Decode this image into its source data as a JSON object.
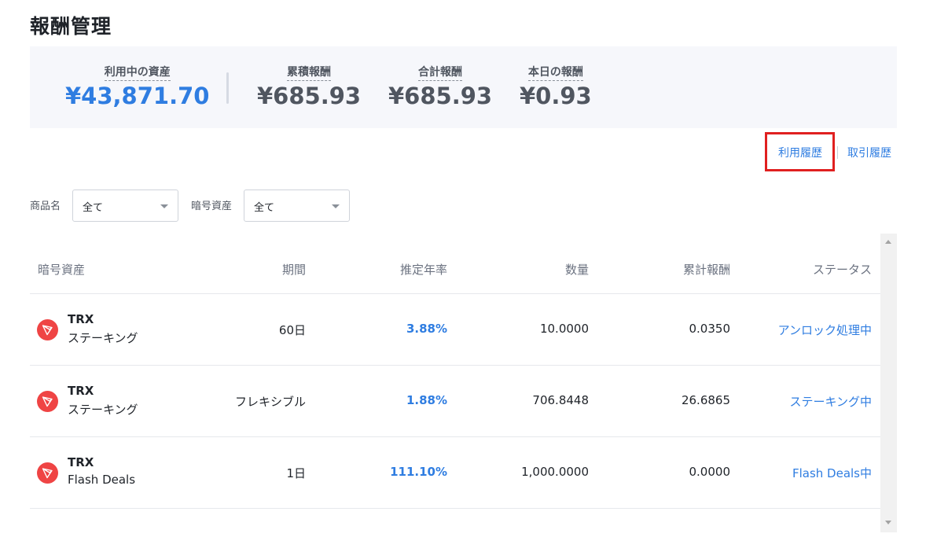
{
  "header": {
    "title": "報酬管理"
  },
  "summary": {
    "in_use_label": "利用中の資産",
    "in_use_value": "¥43,871.70",
    "cumulative_label": "累積報酬",
    "cumulative_value": "¥685.93",
    "total_label": "合計報酬",
    "total_value": "¥685.93",
    "today_label": "本日の報酬",
    "today_value": "¥0.93"
  },
  "links": {
    "usage_history": "利用履歴",
    "trade_history": "取引履歴"
  },
  "filters": {
    "product_label": "商品名",
    "product_value": "全て",
    "asset_label": "暗号資産",
    "asset_value": "全て"
  },
  "table": {
    "columns": {
      "asset": "暗号資産",
      "period": "期間",
      "apr": "推定年率",
      "amount": "数量",
      "reward": "累計報酬",
      "status": "ステータス"
    },
    "rows": [
      {
        "coin": "TRX",
        "product": "ステーキング",
        "period": "60日",
        "apr": "3.88%",
        "amount": "10.0000",
        "reward": "0.0350",
        "status": "アンロック処理中"
      },
      {
        "coin": "TRX",
        "product": "ステーキング",
        "period": "フレキシブル",
        "apr": "1.88%",
        "amount": "706.8448",
        "reward": "26.6865",
        "status": "ステーキング中"
      },
      {
        "coin": "TRX",
        "product": "Flash Deals",
        "period": "1日",
        "apr": "111.10%",
        "amount": "1,000.0000",
        "reward": "0.0000",
        "status": "Flash Deals中"
      }
    ]
  },
  "colors": {
    "accent": "#2f7de1",
    "coin": "#ef4444",
    "highlight": "#e02020"
  },
  "icons": {
    "coin": "tron-icon"
  }
}
